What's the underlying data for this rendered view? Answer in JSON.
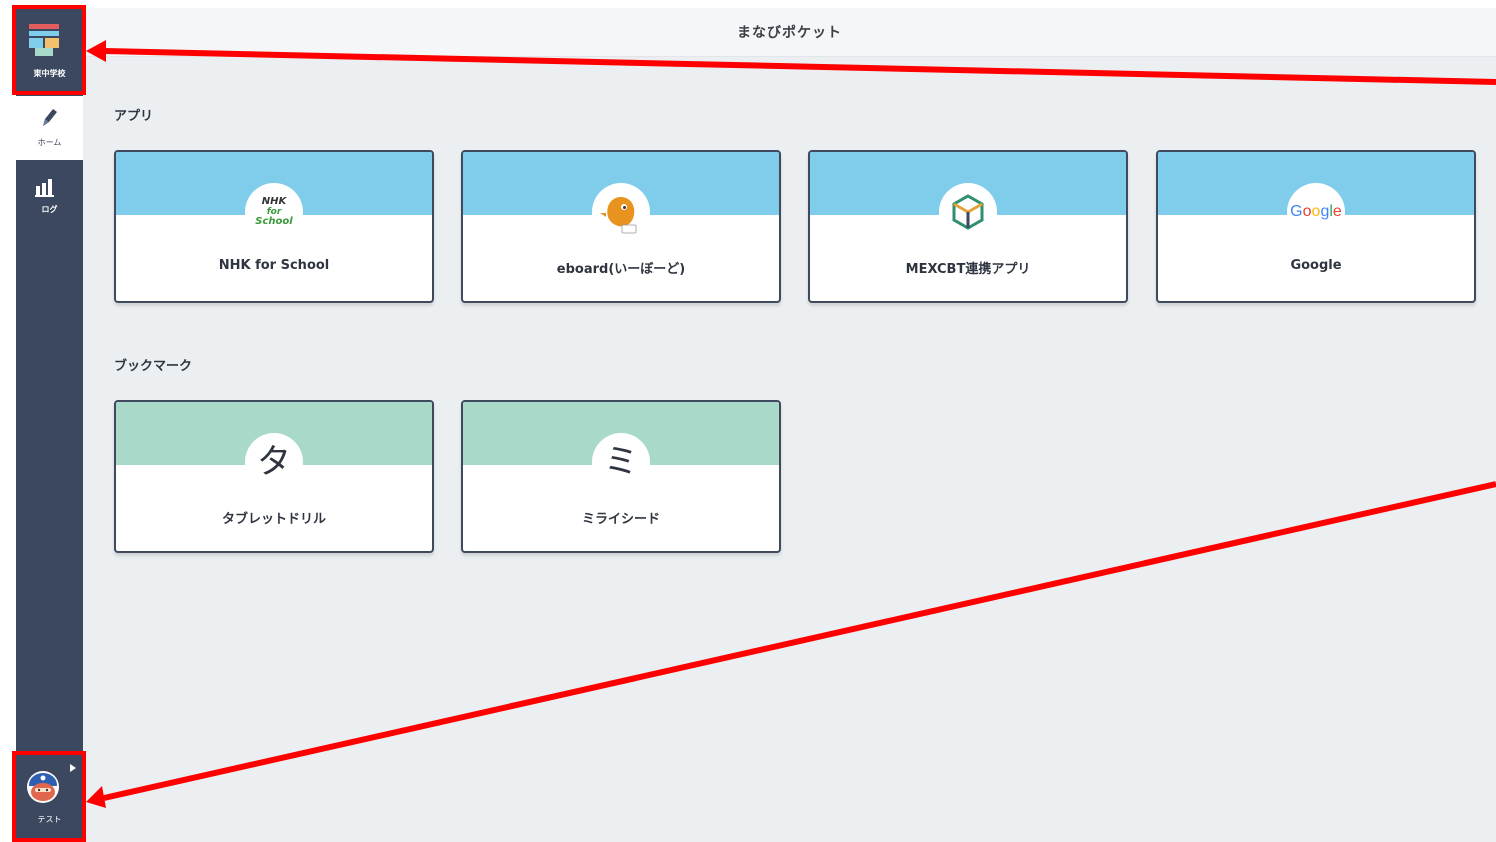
{
  "app": {
    "title": "まなびポケット"
  },
  "sidebar": {
    "school_name": "東中学校",
    "nav": [
      {
        "label": "ホーム",
        "icon": "pencil-icon",
        "active": true
      },
      {
        "label": "ログ",
        "icon": "bar-chart-icon",
        "active": false
      }
    ],
    "user": {
      "name": "テスト",
      "icon": "avatar-icon"
    }
  },
  "sections": {
    "apps": {
      "title": "アプリ",
      "items": [
        {
          "name": "NHK for School",
          "icon": "nhk-for-school-logo",
          "logo_lines": [
            "NHK",
            "for",
            "School"
          ]
        },
        {
          "name": "eboard(いーぼーど)",
          "icon": "eboard-mascot-icon"
        },
        {
          "name": "MEXCBT連携アプリ",
          "icon": "mexcbt-logo-icon"
        },
        {
          "name": "Google",
          "icon": "google-logo",
          "logo_text": "Google"
        }
      ]
    },
    "bookmarks": {
      "title": "ブックマーク",
      "items": [
        {
          "name": "タブレットドリル",
          "letter": "タ"
        },
        {
          "name": "ミライシード",
          "letter": "ミ"
        }
      ]
    }
  },
  "colors": {
    "sidebar": "#3c4760",
    "app_band": "#7fcdea",
    "bookmark_band": "#a9d9c9",
    "annotation": "#ff0000",
    "background": "#eceff2"
  }
}
